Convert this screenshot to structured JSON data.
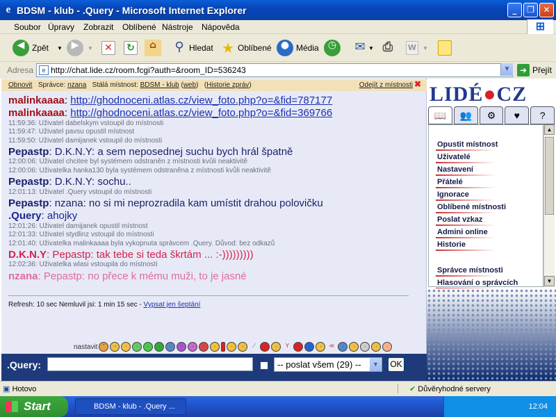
{
  "window": {
    "title": "BDSM - klub - .Query - Microsoft Internet Explorer"
  },
  "menubar": [
    "Soubor",
    "Úpravy",
    "Zobrazit",
    "Oblíbené",
    "Nástroje",
    "Nápověda"
  ],
  "toolbar": {
    "back": "Zpět",
    "search": "Hledat",
    "favorites": "Oblíbené",
    "media": "Média"
  },
  "address": {
    "label": "Adresa",
    "url": "http://chat.lide.cz/room.fcgi?auth=&room_ID=536243",
    "go": "Přejít"
  },
  "room_bar": {
    "refresh": "Obnovit",
    "admin_label": "Správce:",
    "admin": "nzana",
    "permanent_label": "Stálá místnost:",
    "room": "BDSM - klub",
    "web": "web",
    "history": "Historie zpráv",
    "leave": "Odejít z místnosti"
  },
  "messages": [
    {
      "user": "malinkaaaa",
      "text": "http://ghodnoceni.atlas.cz/view_foto.php?o=&fid=787177",
      "type": "link"
    },
    {
      "user": "malinkaaaa",
      "text": "http://ghodnoceni.atlas.cz/view_foto.php?o=&fid=369766",
      "type": "link"
    },
    {
      "text": "11:59:36: Uživatel dabelskym vstoupil do místnosti",
      "type": "sys"
    },
    {
      "text": "11:59:47: Uživatel pavsu opustil místnost",
      "type": "sys"
    },
    {
      "text": "11:59:50: Uživatel damijanek vstoupil do místnosti",
      "type": "sys"
    },
    {
      "user": "Pepastp",
      "text": ": D.K.N.Y: a sem neposednej suchu bych hrál špatně",
      "type": "msg",
      "color": "#1b1f6a"
    },
    {
      "text": "12:00:06: Uživatel chcitee byl systémem odstraněn z místnosti kvůli neaktivitě",
      "type": "sys"
    },
    {
      "text": "12:00:06: Uživatelka hanka130 byla systémem odstraněna z místnosti kvůli neaktivitě",
      "type": "sys"
    },
    {
      "user": "Pepastp",
      "text": ": D.K.N.Y: sochu..",
      "type": "msg",
      "color": "#1b1f6a"
    },
    {
      "text": "12:01:13: Uživatel .Query vstoupil do místnosti",
      "type": "sys"
    },
    {
      "user": "Pepastp",
      "text": ": nzana: no si mi neprozradila kam umístit drahou polovičku",
      "type": "msg",
      "color": "#1b1f6a"
    },
    {
      "user": ".Query",
      "text": ": ahojky",
      "type": "msg",
      "color": "#1a2590"
    },
    {
      "text": "12:01:26: Uživatel damijanek opustil místnost",
      "type": "sys"
    },
    {
      "text": "12:01:33: Uživatel stydlinz vstoupil do místnosti",
      "type": "sys"
    },
    {
      "text": "12:01:40: Uživatelka malinkaaaa byla vykopnuta správcem .Query. Důvod: bez odkazů",
      "type": "sys"
    },
    {
      "user": "D.K.N.Y",
      "text": ": Pepastp: tak tebe si teda škrtám ... :-)))))))))",
      "type": "msg",
      "color": "#d4204e"
    },
    {
      "text": "12:02:36: Uživatelka wlasi vstoupila do místnosti",
      "type": "sys"
    },
    {
      "user": "nzana",
      "text": ": Pepastp: no přece k mému muži, to je jasné",
      "type": "msg",
      "color": "#e06aa0"
    }
  ],
  "refresh_info": {
    "text": "Refresh: 10 sec    Nemluvil jsi: 1 min 15 sec - ",
    "link": "Vypsat jen šeptání"
  },
  "emoticons_label": "nastavit",
  "input": {
    "nick": ".Query:",
    "select": "-- poslat všem (29) --",
    "ok": "OK"
  },
  "side": {
    "logo_left": "LIDÉ",
    "logo_right": "CZ",
    "menu": [
      "Opustit místnost",
      "Uživatelé",
      "Nastavení",
      "Přátelé",
      "Ignorace",
      "Oblíbené místnosti",
      "Poslat vzkaz",
      "Admini online",
      "Historie",
      "Správce místnosti",
      "Hlasování o správcích"
    ]
  },
  "status": {
    "left": "Hotovo",
    "zone": "Důvěryhodné servery"
  },
  "taskbar": {
    "start": "Start",
    "task": "BDSM - klub - .Query ...",
    "clock": "12:04"
  }
}
